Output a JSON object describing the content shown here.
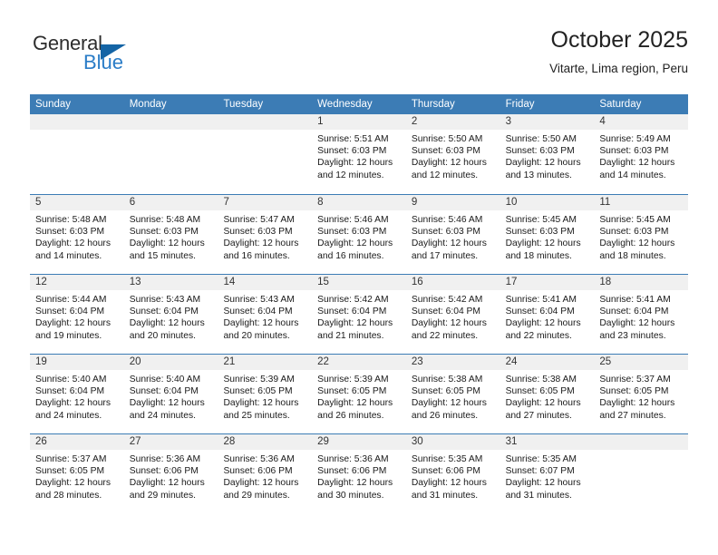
{
  "brand": {
    "name_top": "General",
    "name_bottom": "Blue",
    "triangle_color": "#1464a5",
    "blue_color": "#2a7cc7"
  },
  "header": {
    "title": "October 2025",
    "subtitle": "Vitarte, Lima region, Peru",
    "header_bg_color": "#3c7cb5",
    "daynum_bg_color": "#f0f0f0"
  },
  "weekdays": [
    "Sunday",
    "Monday",
    "Tuesday",
    "Wednesday",
    "Thursday",
    "Friday",
    "Saturday"
  ],
  "weeks": [
    [
      {
        "day": "",
        "sunrise": "",
        "sunset": "",
        "daylight1": "",
        "daylight2": ""
      },
      {
        "day": "",
        "sunrise": "",
        "sunset": "",
        "daylight1": "",
        "daylight2": ""
      },
      {
        "day": "",
        "sunrise": "",
        "sunset": "",
        "daylight1": "",
        "daylight2": ""
      },
      {
        "day": "1",
        "sunrise": "Sunrise: 5:51 AM",
        "sunset": "Sunset: 6:03 PM",
        "daylight1": "Daylight: 12 hours",
        "daylight2": "and 12 minutes."
      },
      {
        "day": "2",
        "sunrise": "Sunrise: 5:50 AM",
        "sunset": "Sunset: 6:03 PM",
        "daylight1": "Daylight: 12 hours",
        "daylight2": "and 12 minutes."
      },
      {
        "day": "3",
        "sunrise": "Sunrise: 5:50 AM",
        "sunset": "Sunset: 6:03 PM",
        "daylight1": "Daylight: 12 hours",
        "daylight2": "and 13 minutes."
      },
      {
        "day": "4",
        "sunrise": "Sunrise: 5:49 AM",
        "sunset": "Sunset: 6:03 PM",
        "daylight1": "Daylight: 12 hours",
        "daylight2": "and 14 minutes."
      }
    ],
    [
      {
        "day": "5",
        "sunrise": "Sunrise: 5:48 AM",
        "sunset": "Sunset: 6:03 PM",
        "daylight1": "Daylight: 12 hours",
        "daylight2": "and 14 minutes."
      },
      {
        "day": "6",
        "sunrise": "Sunrise: 5:48 AM",
        "sunset": "Sunset: 6:03 PM",
        "daylight1": "Daylight: 12 hours",
        "daylight2": "and 15 minutes."
      },
      {
        "day": "7",
        "sunrise": "Sunrise: 5:47 AM",
        "sunset": "Sunset: 6:03 PM",
        "daylight1": "Daylight: 12 hours",
        "daylight2": "and 16 minutes."
      },
      {
        "day": "8",
        "sunrise": "Sunrise: 5:46 AM",
        "sunset": "Sunset: 6:03 PM",
        "daylight1": "Daylight: 12 hours",
        "daylight2": "and 16 minutes."
      },
      {
        "day": "9",
        "sunrise": "Sunrise: 5:46 AM",
        "sunset": "Sunset: 6:03 PM",
        "daylight1": "Daylight: 12 hours",
        "daylight2": "and 17 minutes."
      },
      {
        "day": "10",
        "sunrise": "Sunrise: 5:45 AM",
        "sunset": "Sunset: 6:03 PM",
        "daylight1": "Daylight: 12 hours",
        "daylight2": "and 18 minutes."
      },
      {
        "day": "11",
        "sunrise": "Sunrise: 5:45 AM",
        "sunset": "Sunset: 6:03 PM",
        "daylight1": "Daylight: 12 hours",
        "daylight2": "and 18 minutes."
      }
    ],
    [
      {
        "day": "12",
        "sunrise": "Sunrise: 5:44 AM",
        "sunset": "Sunset: 6:04 PM",
        "daylight1": "Daylight: 12 hours",
        "daylight2": "and 19 minutes."
      },
      {
        "day": "13",
        "sunrise": "Sunrise: 5:43 AM",
        "sunset": "Sunset: 6:04 PM",
        "daylight1": "Daylight: 12 hours",
        "daylight2": "and 20 minutes."
      },
      {
        "day": "14",
        "sunrise": "Sunrise: 5:43 AM",
        "sunset": "Sunset: 6:04 PM",
        "daylight1": "Daylight: 12 hours",
        "daylight2": "and 20 minutes."
      },
      {
        "day": "15",
        "sunrise": "Sunrise: 5:42 AM",
        "sunset": "Sunset: 6:04 PM",
        "daylight1": "Daylight: 12 hours",
        "daylight2": "and 21 minutes."
      },
      {
        "day": "16",
        "sunrise": "Sunrise: 5:42 AM",
        "sunset": "Sunset: 6:04 PM",
        "daylight1": "Daylight: 12 hours",
        "daylight2": "and 22 minutes."
      },
      {
        "day": "17",
        "sunrise": "Sunrise: 5:41 AM",
        "sunset": "Sunset: 6:04 PM",
        "daylight1": "Daylight: 12 hours",
        "daylight2": "and 22 minutes."
      },
      {
        "day": "18",
        "sunrise": "Sunrise: 5:41 AM",
        "sunset": "Sunset: 6:04 PM",
        "daylight1": "Daylight: 12 hours",
        "daylight2": "and 23 minutes."
      }
    ],
    [
      {
        "day": "19",
        "sunrise": "Sunrise: 5:40 AM",
        "sunset": "Sunset: 6:04 PM",
        "daylight1": "Daylight: 12 hours",
        "daylight2": "and 24 minutes."
      },
      {
        "day": "20",
        "sunrise": "Sunrise: 5:40 AM",
        "sunset": "Sunset: 6:04 PM",
        "daylight1": "Daylight: 12 hours",
        "daylight2": "and 24 minutes."
      },
      {
        "day": "21",
        "sunrise": "Sunrise: 5:39 AM",
        "sunset": "Sunset: 6:05 PM",
        "daylight1": "Daylight: 12 hours",
        "daylight2": "and 25 minutes."
      },
      {
        "day": "22",
        "sunrise": "Sunrise: 5:39 AM",
        "sunset": "Sunset: 6:05 PM",
        "daylight1": "Daylight: 12 hours",
        "daylight2": "and 26 minutes."
      },
      {
        "day": "23",
        "sunrise": "Sunrise: 5:38 AM",
        "sunset": "Sunset: 6:05 PM",
        "daylight1": "Daylight: 12 hours",
        "daylight2": "and 26 minutes."
      },
      {
        "day": "24",
        "sunrise": "Sunrise: 5:38 AM",
        "sunset": "Sunset: 6:05 PM",
        "daylight1": "Daylight: 12 hours",
        "daylight2": "and 27 minutes."
      },
      {
        "day": "25",
        "sunrise": "Sunrise: 5:37 AM",
        "sunset": "Sunset: 6:05 PM",
        "daylight1": "Daylight: 12 hours",
        "daylight2": "and 27 minutes."
      }
    ],
    [
      {
        "day": "26",
        "sunrise": "Sunrise: 5:37 AM",
        "sunset": "Sunset: 6:05 PM",
        "daylight1": "Daylight: 12 hours",
        "daylight2": "and 28 minutes."
      },
      {
        "day": "27",
        "sunrise": "Sunrise: 5:36 AM",
        "sunset": "Sunset: 6:06 PM",
        "daylight1": "Daylight: 12 hours",
        "daylight2": "and 29 minutes."
      },
      {
        "day": "28",
        "sunrise": "Sunrise: 5:36 AM",
        "sunset": "Sunset: 6:06 PM",
        "daylight1": "Daylight: 12 hours",
        "daylight2": "and 29 minutes."
      },
      {
        "day": "29",
        "sunrise": "Sunrise: 5:36 AM",
        "sunset": "Sunset: 6:06 PM",
        "daylight1": "Daylight: 12 hours",
        "daylight2": "and 30 minutes."
      },
      {
        "day": "30",
        "sunrise": "Sunrise: 5:35 AM",
        "sunset": "Sunset: 6:06 PM",
        "daylight1": "Daylight: 12 hours",
        "daylight2": "and 31 minutes."
      },
      {
        "day": "31",
        "sunrise": "Sunrise: 5:35 AM",
        "sunset": "Sunset: 6:07 PM",
        "daylight1": "Daylight: 12 hours",
        "daylight2": "and 31 minutes."
      },
      {
        "day": "",
        "sunrise": "",
        "sunset": "",
        "daylight1": "",
        "daylight2": ""
      }
    ]
  ]
}
